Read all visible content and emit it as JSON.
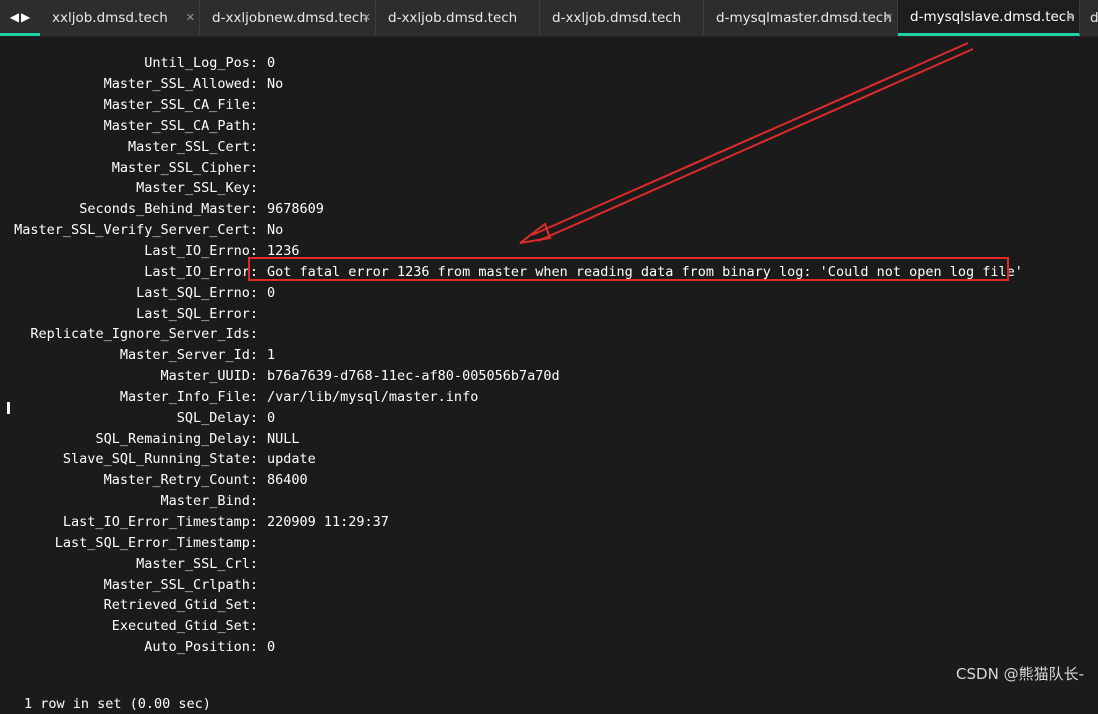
{
  "tabs": [
    {
      "label": "xxljob.dmsd.tech",
      "active": false,
      "closable": true
    },
    {
      "label": "d-xxljobnew.dmsd.tech",
      "active": false,
      "closable": true
    },
    {
      "label": "d-xxljob.dmsd.tech",
      "active": false,
      "closable": false
    },
    {
      "label": "d-xxljob.dmsd.tech",
      "active": false,
      "closable": false
    },
    {
      "label": "d-mysqlmaster.dmsd.tech",
      "active": false,
      "closable": true
    },
    {
      "label": "d-mysqlslave.dmsd.tech",
      "active": true,
      "closable": true
    },
    {
      "label": "d",
      "active": false,
      "closable": false
    }
  ],
  "terminal": {
    "rows": [
      {
        "key": "Until_Log_Pos:",
        "value": "0"
      },
      {
        "key": "Master_SSL_Allowed:",
        "value": "No"
      },
      {
        "key": "Master_SSL_CA_File:",
        "value": ""
      },
      {
        "key": "Master_SSL_CA_Path:",
        "value": ""
      },
      {
        "key": "Master_SSL_Cert:",
        "value": ""
      },
      {
        "key": "Master_SSL_Cipher:",
        "value": ""
      },
      {
        "key": "Master_SSL_Key:",
        "value": ""
      },
      {
        "key": "Seconds_Behind_Master:",
        "value": "9678609"
      },
      {
        "key": "Master_SSL_Verify_Server_Cert:",
        "value": "No"
      },
      {
        "key": "Last_IO_Errno:",
        "value": "1236"
      },
      {
        "key": "Last_IO_Error:",
        "value": "Got fatal error 1236 from master when reading data from binary log: 'Could not open log file'"
      },
      {
        "key": "Last_SQL_Errno:",
        "value": "0"
      },
      {
        "key": "Last_SQL_Error:",
        "value": ""
      },
      {
        "key": "Replicate_Ignore_Server_Ids:",
        "value": ""
      },
      {
        "key": "Master_Server_Id:",
        "value": "1"
      },
      {
        "key": "Master_UUID:",
        "value": "b76a7639-d768-11ec-af80-005056b7a70d"
      },
      {
        "key": "Master_Info_File:",
        "value": "/var/lib/mysql/master.info"
      },
      {
        "key": "SQL_Delay:",
        "value": "0"
      },
      {
        "key": "SQL_Remaining_Delay:",
        "value": "NULL"
      },
      {
        "key": "Slave_SQL_Running_State:",
        "value": "update"
      },
      {
        "key": "Master_Retry_Count:",
        "value": "86400"
      },
      {
        "key": "Master_Bind:",
        "value": ""
      },
      {
        "key": "Last_IO_Error_Timestamp:",
        "value": "220909 11:29:37"
      },
      {
        "key": "Last_SQL_Error_Timestamp:",
        "value": ""
      },
      {
        "key": "Master_SSL_Crl:",
        "value": ""
      },
      {
        "key": "Master_SSL_Crlpath:",
        "value": ""
      },
      {
        "key": "Retrieved_Gtid_Set:",
        "value": ""
      },
      {
        "key": "Executed_Gtid_Set:",
        "value": ""
      },
      {
        "key": "Auto_Position:",
        "value": "0"
      }
    ],
    "footer": "1 row in set (0.00 sec)"
  },
  "watermark": "CSDN @熊猫队长-",
  "colors": {
    "accent": "#1ed3a6",
    "annotation": "#e02a2a",
    "background": "#1b1b1b",
    "text": "#ffffff"
  },
  "icons": {
    "nav": "left-right-arrows-icon",
    "close": "close-icon"
  }
}
